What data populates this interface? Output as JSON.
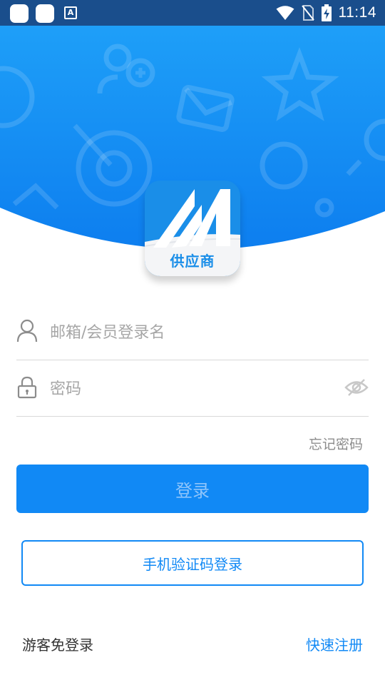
{
  "status_bar": {
    "time": "11:14",
    "indicator_letter": "A"
  },
  "logo": {
    "caption": "供应商"
  },
  "form": {
    "username_placeholder": "邮箱/会员登录名",
    "username_value": "",
    "password_placeholder": "密码",
    "password_value": ""
  },
  "forgot_password": "忘记密码",
  "login_button": "登录",
  "sms_login_button": "手机验证码登录",
  "guest_link": "游客免登录",
  "register_link": "快速注册",
  "colors": {
    "brand_blue": "#1189f5",
    "status_bar": "#1a4e8c",
    "header_gradient_top": "#1a9af7",
    "header_gradient_bottom": "#0f7ff0"
  }
}
